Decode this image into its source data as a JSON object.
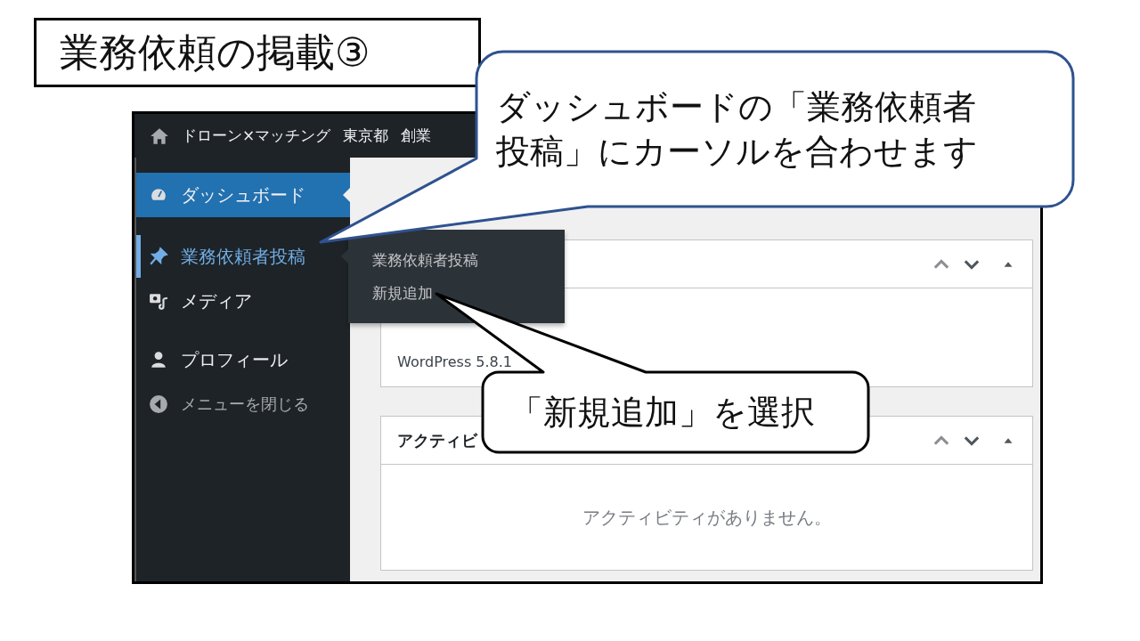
{
  "slide_title": "業務依頼の掲載③",
  "admin_bar": {
    "site_name": "ドローン×マッチング",
    "items": [
      "東京都",
      "創業"
    ]
  },
  "sidebar": {
    "items": [
      {
        "label": "ダッシュボード",
        "kind": "dashboard",
        "selected": true,
        "hovered": false
      },
      {
        "label": "業務依頼者投稿",
        "kind": "pin",
        "selected": false,
        "hovered": true
      },
      {
        "label": "メディア",
        "kind": "media",
        "selected": false,
        "hovered": false
      },
      {
        "label": "プロフィール",
        "kind": "profile",
        "selected": false,
        "hovered": false
      },
      {
        "label": "メニューを閉じる",
        "kind": "collapse",
        "selected": false,
        "hovered": false
      }
    ]
  },
  "submenu": {
    "items": [
      "業務依頼者投稿",
      "新規追加"
    ]
  },
  "cards": [
    {
      "body": "WordPress 5.8.1"
    },
    {
      "title": "アクティビ",
      "body": "アクティビティがありません。"
    }
  ],
  "callouts": [
    {
      "kind": "blue",
      "lines": [
        "ダッシュボードの「業務依頼者",
        "投稿」にカーソルを合わせます"
      ]
    },
    {
      "kind": "black",
      "lines": [
        "「新規追加」を選択"
      ]
    }
  ]
}
